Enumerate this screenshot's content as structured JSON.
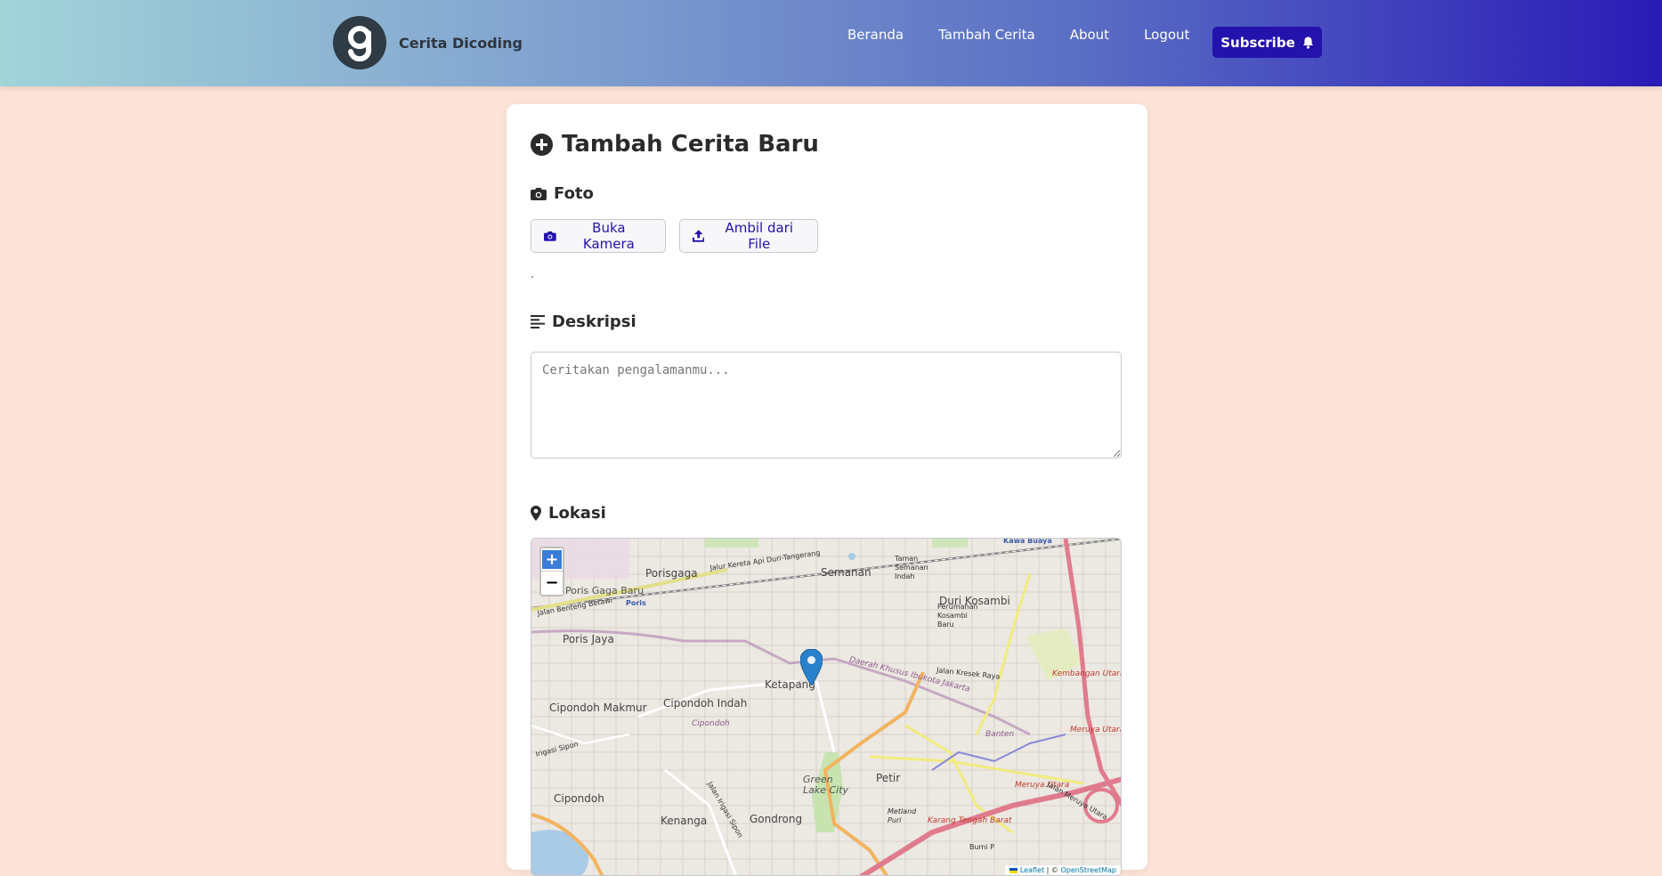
{
  "header": {
    "brand_name": "Cerita Dicoding",
    "logo_icon": "g-logo-icon",
    "nav": [
      "Beranda",
      "Tambah Cerita",
      "About",
      "Logout"
    ],
    "subscribe_label": "Subscribe",
    "colors": {
      "subscribe_bg": "#2412ad",
      "gradient_start": "#a2d4d8",
      "gradient_end": "#2a1ab6"
    }
  },
  "form": {
    "title": "Tambah Cerita Baru",
    "title_icon": "plus-circle-icon",
    "photo_section": {
      "label": "Foto",
      "icon": "camera-icon"
    },
    "camera_button": "Buka Kamera",
    "file_button": "Ambil dari File",
    "description_section": {
      "label": "Deskripsi",
      "icon": "align-left-icon"
    },
    "description": {
      "value": "",
      "placeholder": "Ceritakan pengalamanmu..."
    },
    "location_section": {
      "label": "Lokasi",
      "icon": "map-pin-icon"
    }
  },
  "map": {
    "zoom_in": "+",
    "zoom_out": "−",
    "labels": {
      "porisgaga": "Porisgaga",
      "semanan": "Semanan",
      "duri_kosambi": "Duri Kosambi",
      "poris_jaya": "Poris Jaya",
      "ketapang": "Ketapang",
      "cipondoh_makmur": "Cipondoh Makmur",
      "cipondoh_indah": "Cipondoh Indah",
      "cipondoh": "Cipondoh",
      "cipondoh_water": "Cipondoh",
      "green_lake": "Green Lake City",
      "petir": "Petir",
      "kenanga": "Kenanga",
      "gondrong": "Gondrong",
      "poris_gaga_baru": "Poris Gaga Baru",
      "poris": "Poris",
      "jalan_benteng_betawi": "Jalan Benteng Betawi",
      "jalur_kereta": "Jalur Kereta Api Duri-Tangerang",
      "jalan_kresek_raya": "Jalan Kresek Raya",
      "kembangan_utara": "Kembangan Utara",
      "meruya_utara": "Meruya Utara",
      "meruya_utara2": "Meruya Utara",
      "karang_tengah_barat": "Karang Tengah Barat",
      "banten": "Banten",
      "daerah_khusus": "Daerah Khusus Ibukota Jakarta",
      "irigasi_sipon": "Irigasi Sipon",
      "jalan_irigasi_sipon": "Jalan Irigasi Sipon",
      "perumahan_kosambi": "Perumahan Kosambi Baru",
      "taman_semanan": "Taman Semanan Indah",
      "kawa_buaya": "Kawa Buaya",
      "jalan_meruya": "Jalan Meruya Utara",
      "metland": "Metland Puri",
      "bumi": "Bumi P"
    },
    "attribution": {
      "leaflet": "Leaflet",
      "separator": "| ©",
      "osm": "OpenStreetMap"
    },
    "marker_color": "#2a81cb"
  }
}
